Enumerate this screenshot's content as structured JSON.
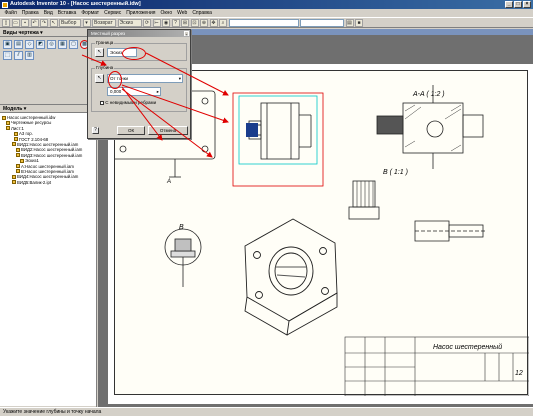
{
  "window": {
    "title": "Autodesk Inventor 10 - [Насос шестеренный.idw]",
    "controls": [
      "_",
      "□",
      "×"
    ]
  },
  "menu": [
    "Файл",
    "Правка",
    "Вид",
    "Вставка",
    "Формат",
    "Сервис",
    "Приложения",
    "Окно",
    "Web",
    "Справка"
  ],
  "toolbar": {
    "select_label": "Выбор",
    "return_label": "Возврат",
    "sketch_label": "Эскиз",
    "combo_value": ""
  },
  "left_panel": {
    "views_header": "Виды чертежа ▾",
    "model_header": "Модель ▾",
    "tree": [
      "Насос шестеренный.idw",
      "Чертежные ресурсы",
      "Лист:1",
      "A3 гор.",
      "ГОСТ 2.104-68",
      "ВИД1:Насос шестеренный.iam",
      "ВИД2:Насос шестеренный.iam",
      "ВИД3:Насос шестеренный.iam",
      "Эскиз1",
      "A:Насос шестеренный.iam",
      "B:Насос шестеренный.iam",
      "ВИД4:Насос шестеренный.iam",
      "ВИД5:Валик-2.ipt"
    ]
  },
  "dialog": {
    "title": "Местный разрез",
    "boundary_label": "Граница",
    "boundary_value": "Эскиз",
    "depth_label": "Глубина",
    "depth_mode": "От точки",
    "depth_value": "0,000",
    "checkbox_label": "С невидимыми ребрами",
    "ok_label": "ОК",
    "cancel_label": "Отмена"
  },
  "drawing": {
    "label_section": "A-A ( 1:2 )",
    "label_b_scale": "B ( 1:1 )",
    "label_b": "B",
    "label_a": "A",
    "title_block_name": "Насос шестеренный",
    "sheet_number": "12"
  },
  "status": {
    "text": "Укажите значение глубины и точку начала"
  },
  "colors": {
    "highlight_red": "#e00000",
    "sketch_cyan": "#00c8c8",
    "title_bar": "#0a246a"
  }
}
